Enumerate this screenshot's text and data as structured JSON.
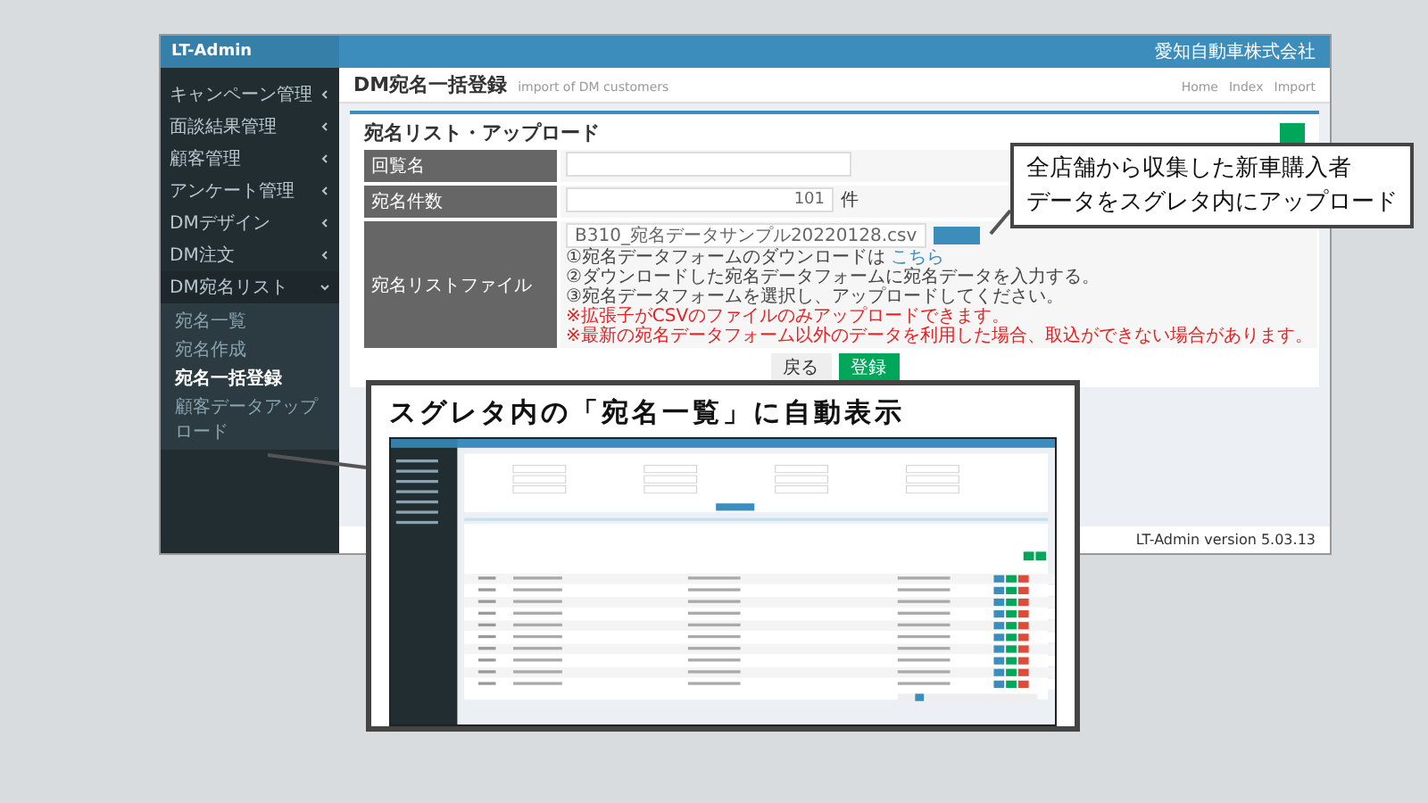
{
  "app": {
    "logo": "LT-Admin",
    "company": "愛知自動車株式会社",
    "version": "LT-Admin version 5.03.13"
  },
  "sidebar": {
    "items": [
      {
        "label": "キャンペーン管理",
        "expanded": false
      },
      {
        "label": "面談結果管理",
        "expanded": false
      },
      {
        "label": "顧客管理",
        "expanded": false
      },
      {
        "label": "アンケート管理",
        "expanded": false
      },
      {
        "label": "DMデザイン",
        "expanded": false
      },
      {
        "label": "DM注文",
        "expanded": false
      },
      {
        "label": "DM宛名リスト",
        "expanded": true,
        "children": [
          {
            "label": "宛名一覧",
            "selected": false
          },
          {
            "label": "宛名作成",
            "selected": false
          },
          {
            "label": "宛名一括登録",
            "selected": true
          },
          {
            "label": "顧客データアップロード",
            "selected": false
          }
        ]
      }
    ]
  },
  "page": {
    "title": "DM宛名一括登録",
    "subtitle": "import of DM customers",
    "breadcrumb": [
      "Home",
      "Index",
      "Import"
    ]
  },
  "card": {
    "title": "宛名リスト・アップロード",
    "rows": [
      {
        "kind": "text",
        "label": "回覧名"
      },
      {
        "kind": "count",
        "label": "宛名件数",
        "value": "101",
        "unit": "件"
      },
      {
        "kind": "file",
        "label": "宛名リストファイル",
        "value": "B310_宛名データサンプル20220128.csv",
        "notes": [
          {
            "text": "①宛名データフォームのダウンロードは ",
            "link": "こちら",
            "warning": false
          },
          {
            "text": "②ダウンロードした宛名データフォームに宛名データを入力する。",
            "warning": false
          },
          {
            "text": "③宛名データフォームを選択し、アップロードしてください。",
            "warning": false
          },
          {
            "text": "※拡張子がCSVのファイルのみアップロードできます。",
            "warning": true
          },
          {
            "text": "※最新の宛名データフォーム以外のデータを利用した場合、取込ができない場合があります。",
            "warning": true
          }
        ]
      }
    ],
    "buttons": [
      {
        "label": "戻る",
        "kind": "default"
      },
      {
        "label": "登録",
        "kind": "primary"
      }
    ]
  },
  "callout": {
    "lines": [
      "全店舗から収集した新車購入者",
      "データをスグレタ内にアップロード"
    ]
  },
  "preview": {
    "caption": "スグレタ内の「宛名一覧」に自動表示",
    "kind": "picture"
  }
}
